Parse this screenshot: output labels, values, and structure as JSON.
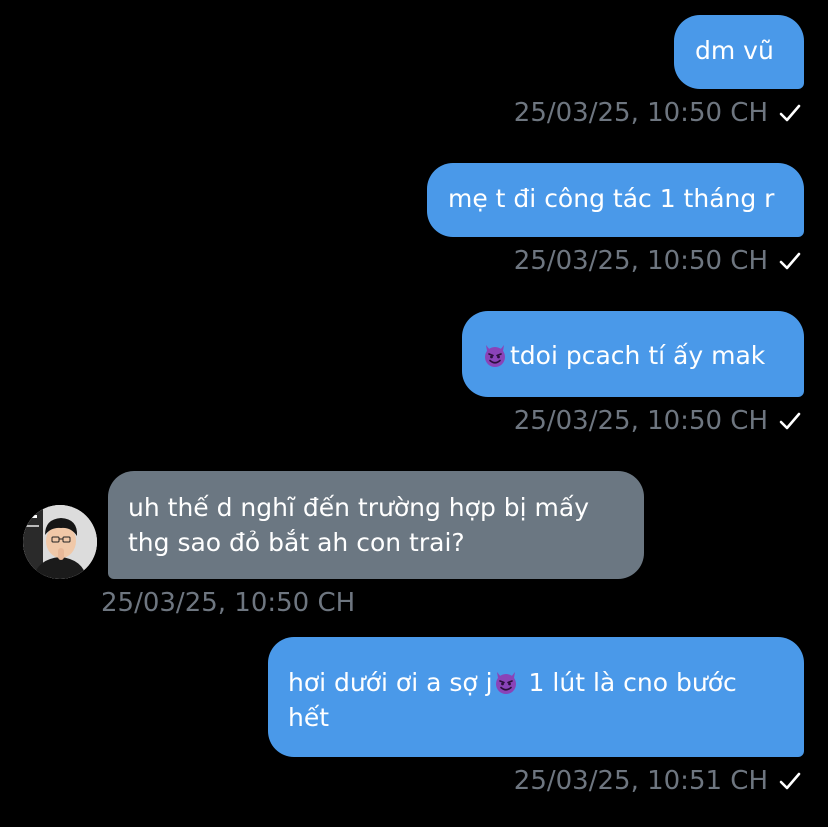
{
  "colors": {
    "background": "#000000",
    "outgoing_bubble": "#4a99e9",
    "incoming_bubble": "#6b7782",
    "timestamp": "#6e7680",
    "text": "#ffffff"
  },
  "messages": [
    {
      "direction": "outgoing",
      "text": "dm vũ",
      "timestamp": "25/03/25, 10:50 CH",
      "status_icon": "check-icon"
    },
    {
      "direction": "outgoing",
      "text": "mẹ t đi công tác 1 tháng r",
      "timestamp": "25/03/25, 10:50 CH",
      "status_icon": "check-icon"
    },
    {
      "direction": "outgoing",
      "emoji": "smiling-devil-emoji",
      "text": "tdoi pcach tí ấy mak",
      "timestamp": "25/03/25, 10:50 CH",
      "status_icon": "check-icon"
    },
    {
      "direction": "incoming",
      "avatar_icon": "user-avatar",
      "text_line1": "uh thế d nghĩ đến trường hợp bị mấy",
      "text_line2": "thg sao đỏ bắt ah con trai?",
      "timestamp": "25/03/25, 10:50 CH"
    },
    {
      "direction": "outgoing",
      "text_before_emoji": "hơi dưới ơi a sợ j",
      "emoji": "smiling-devil-emoji",
      "text_after_emoji": " 1 lút là cno bước",
      "text_line2": "hết",
      "timestamp": "25/03/25, 10:51 CH",
      "status_icon": "check-icon"
    }
  ]
}
